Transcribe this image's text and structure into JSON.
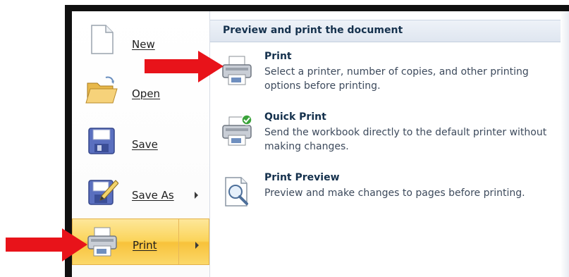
{
  "left_menu": {
    "items": [
      {
        "label": "New",
        "icon": "new-document-icon"
      },
      {
        "label": "Open",
        "icon": "open-folder-icon"
      },
      {
        "label": "Save",
        "icon": "save-disk-icon"
      },
      {
        "label": "Save As",
        "icon": "save-as-icon",
        "has_submenu": true
      },
      {
        "label": "Print",
        "icon": "printer-icon",
        "has_submenu": true,
        "active": true
      }
    ]
  },
  "submenu": {
    "header": "Preview and print the document",
    "items": [
      {
        "title": "Print",
        "description": "Select a printer, number of copies, and other printing options before printing.",
        "icon": "printer-icon"
      },
      {
        "title": "Quick Print",
        "description": "Send the workbook directly to the default printer without making changes.",
        "icon": "quick-print-icon"
      },
      {
        "title": "Print Preview",
        "description": "Preview and make changes to pages before printing.",
        "icon": "print-preview-icon"
      }
    ]
  },
  "colors": {
    "annotation_arrow": "#e8131a",
    "active_highlight": "#fbd45a",
    "header_text": "#15314d"
  }
}
